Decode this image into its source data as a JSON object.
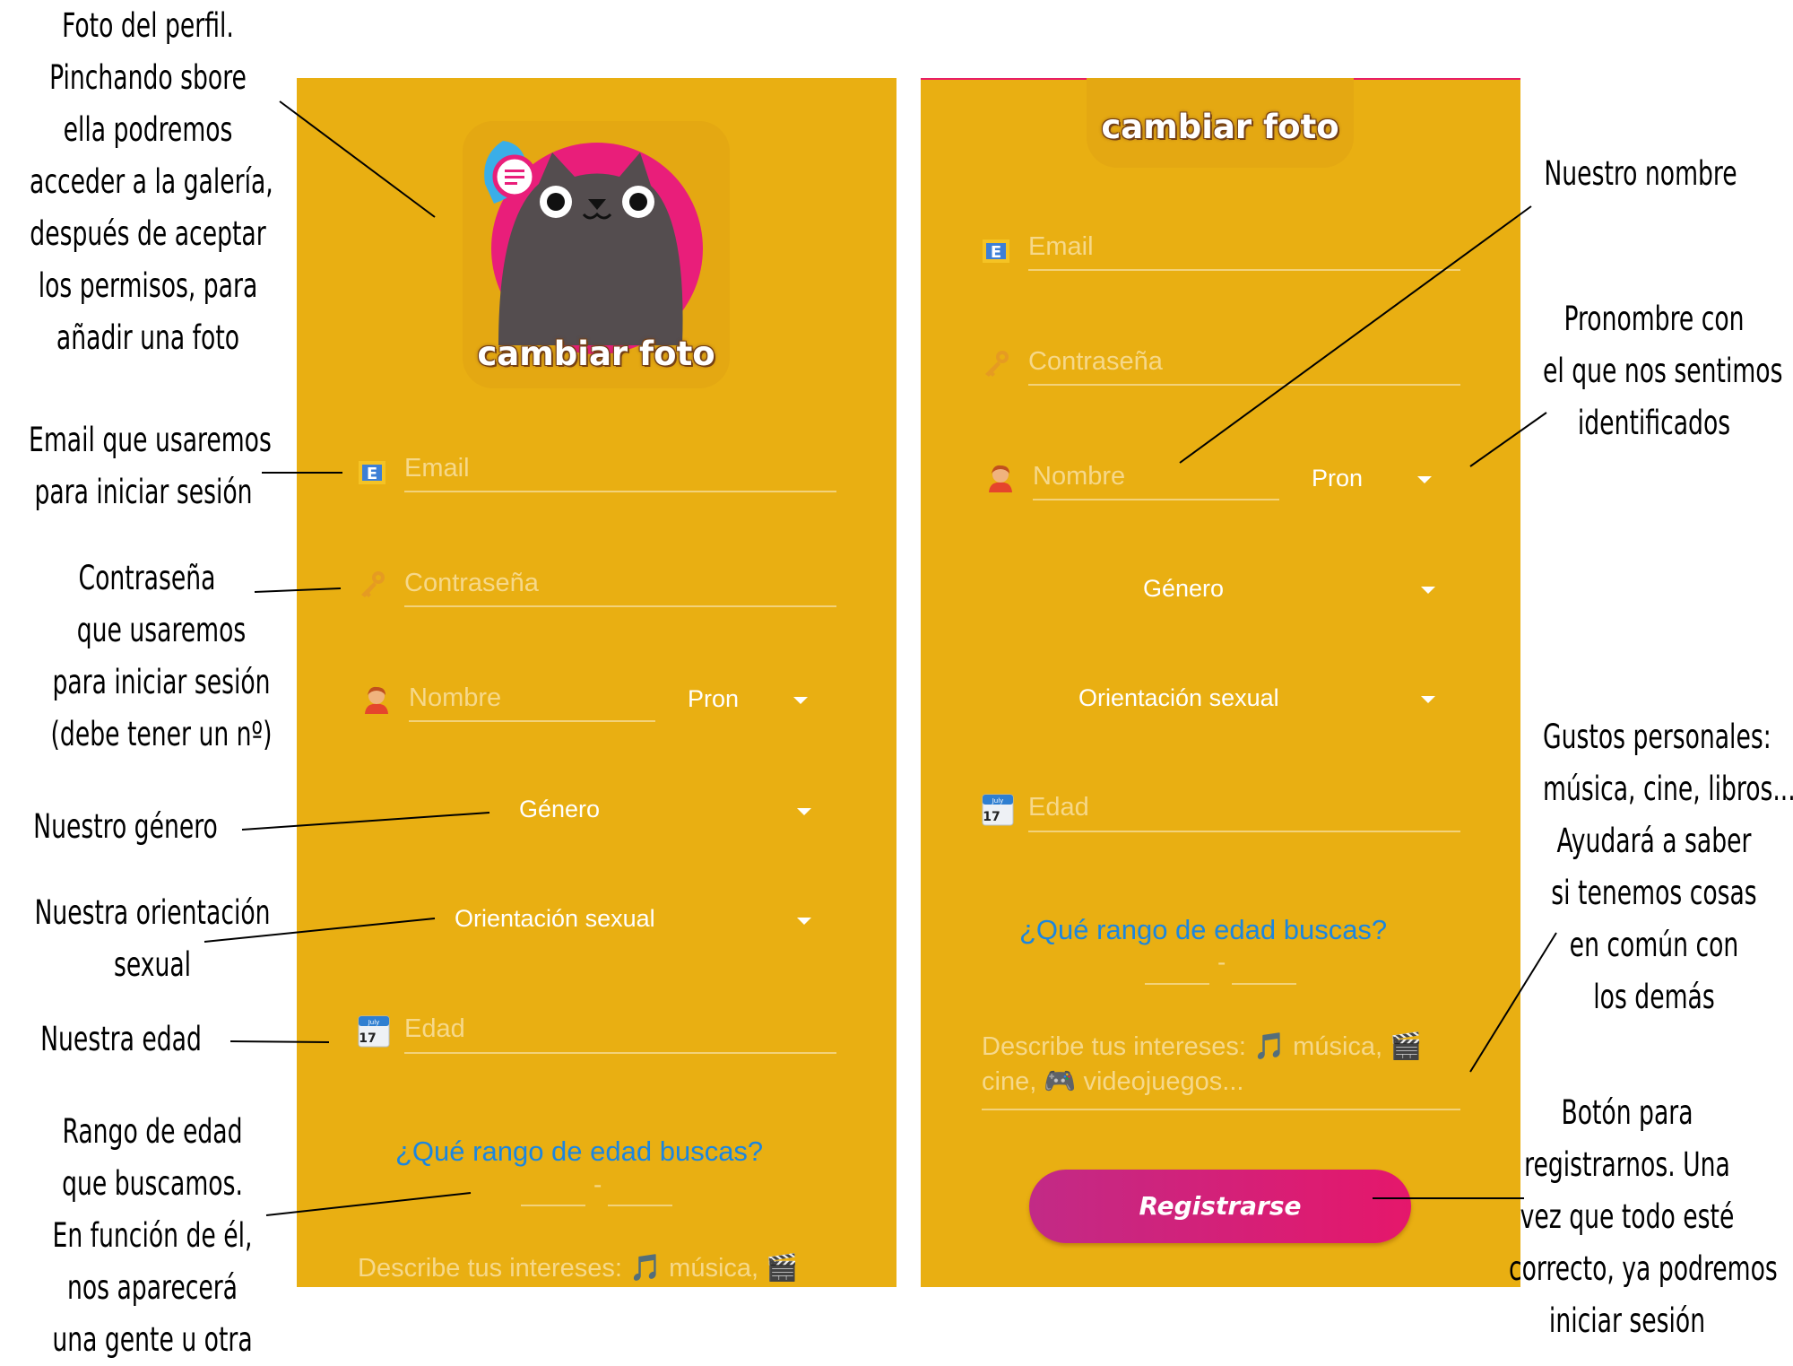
{
  "left_screen": {
    "change_photo": "cambiar foto",
    "email_placeholder": "Email",
    "password_placeholder": "Contraseña",
    "name_placeholder": "Nombre",
    "pronoun_select": "Pron",
    "gender_select": "Género",
    "orientation_select": "Orientación sexual",
    "age_placeholder": "Edad",
    "age_range_question": "¿Qué rango de edad buscas?",
    "range_separator": "-",
    "interests_placeholder": "Describe tus intereses: 🎵 música, 🎬"
  },
  "right_screen": {
    "change_photo": "cambiar foto",
    "email_placeholder": "Email",
    "password_placeholder": "Contraseña",
    "name_placeholder": "Nombre",
    "pronoun_select": "Pron",
    "gender_select": "Género",
    "orientation_select": "Orientación sexual",
    "age_placeholder": "Edad",
    "age_range_question": "¿Qué rango de edad buscas?",
    "range_separator": "-",
    "interests_line1": "Describe tus intereses: 🎵 música, 🎬",
    "interests_line2": "cine, 🎮 videojuegos...",
    "register_button": "Registrarse"
  },
  "calendar_icon": {
    "month": "July",
    "day": "17"
  },
  "annotations": {
    "photo": [
      "Foto del perfil.",
      "Pinchando sbore",
      "ella podremos",
      "acceder a la galería,",
      "después de aceptar",
      "los permisos, para",
      "añadir una foto"
    ],
    "email": [
      "Email que usaremos",
      "para iniciar sesión"
    ],
    "password": [
      "Contraseña",
      "que usaremos",
      "para iniciar sesión",
      "(debe tener un nº)"
    ],
    "gender": [
      "Nuestro género"
    ],
    "orientation": [
      "Nuestra orientación",
      "sexual"
    ],
    "age": [
      "Nuestra edad"
    ],
    "age_range": [
      "Rango de edad",
      "que buscamos.",
      "En función de él,",
      "nos aparecerá",
      "una gente u otra"
    ],
    "name": [
      "Nuestro nombre"
    ],
    "pronoun": [
      "Pronombre con",
      "el que nos sentimos",
      "identificados"
    ],
    "interests": [
      "Gustos personales:",
      "música, cine, libros...",
      "Ayudará a saber",
      "si tenemos cosas",
      "en común con",
      "los demás"
    ],
    "register": [
      "Botón para",
      "registrarnos. Una",
      "vez que todo esté",
      "correcto, ya podremos",
      "iniciar sesión"
    ]
  },
  "colors": {
    "background": "#e9af12",
    "accent_blue": "#1b86e0",
    "button_pink": "#e5176b",
    "avatar_ring": "#e91e7a"
  }
}
